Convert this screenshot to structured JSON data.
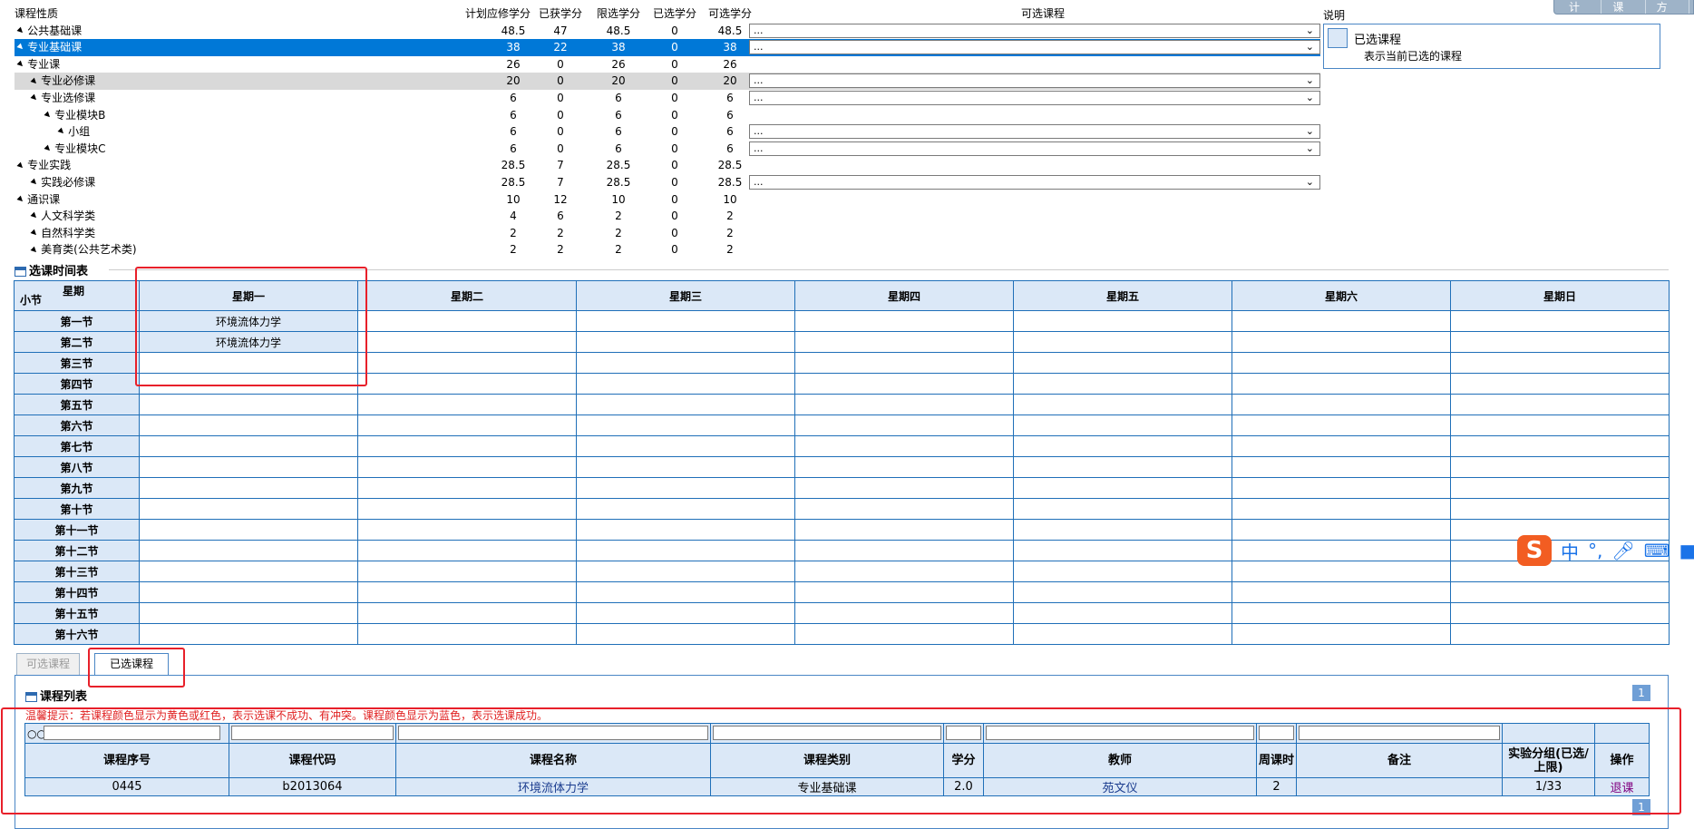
{
  "top_buttons": [
    "计划",
    "课表",
    "方案"
  ],
  "plan": {
    "headers": {
      "name": "课程性质",
      "c1": "计划应修学分",
      "c2": "已获学分",
      "c3": "限选学分",
      "c4": "已选学分",
      "c5": "可选学分",
      "avail": "可选课程"
    },
    "rows": [
      {
        "name": "公共基础课",
        "level": 0,
        "v": [
          "48.5",
          "47",
          "48.5",
          "0",
          "48.5"
        ],
        "dropdown": "..."
      },
      {
        "name": "专业基础课",
        "level": 0,
        "v": [
          "38",
          "22",
          "38",
          "0",
          "38"
        ],
        "dropdown": "...",
        "selected": true
      },
      {
        "name": "专业课",
        "level": 0,
        "v": [
          "26",
          "0",
          "26",
          "0",
          "26"
        ]
      },
      {
        "name": "专业必修课",
        "level": 1,
        "v": [
          "20",
          "0",
          "20",
          "0",
          "20"
        ],
        "dropdown": "...",
        "highlight": true
      },
      {
        "name": "专业选修课",
        "level": 1,
        "v": [
          "6",
          "0",
          "6",
          "0",
          "6"
        ],
        "dropdown": "..."
      },
      {
        "name": "专业模块B",
        "level": 2,
        "v": [
          "6",
          "0",
          "6",
          "0",
          "6"
        ]
      },
      {
        "name": "小组",
        "level": 3,
        "v": [
          "6",
          "0",
          "6",
          "0",
          "6"
        ],
        "dropdown": "..."
      },
      {
        "name": "专业模块C",
        "level": 2,
        "v": [
          "6",
          "0",
          "6",
          "0",
          "6"
        ],
        "dropdown": "..."
      },
      {
        "name": "专业实践",
        "level": 0,
        "v": [
          "28.5",
          "7",
          "28.5",
          "0",
          "28.5"
        ]
      },
      {
        "name": "实践必修课",
        "level": 1,
        "v": [
          "28.5",
          "7",
          "28.5",
          "0",
          "28.5"
        ],
        "dropdown": "..."
      },
      {
        "name": "通识课",
        "level": 0,
        "v": [
          "10",
          "12",
          "10",
          "0",
          "10"
        ]
      },
      {
        "name": "人文科学类",
        "level": 1,
        "v": [
          "4",
          "6",
          "2",
          "0",
          "2"
        ]
      },
      {
        "name": "自然科学类",
        "level": 1,
        "v": [
          "2",
          "2",
          "2",
          "0",
          "2"
        ]
      },
      {
        "name": "美育类(公共艺术类)",
        "level": 1,
        "v": [
          "2",
          "2",
          "2",
          "0",
          "2"
        ]
      }
    ]
  },
  "legend": {
    "title": "说明",
    "item": "已选课程",
    "desc": "表示当前已选的课程"
  },
  "timetable": {
    "title": "选课时间表",
    "corner_top": "星期",
    "corner_bottom": "小节",
    "days": [
      "星期一",
      "星期二",
      "星期三",
      "星期四",
      "星期五",
      "星期六",
      "星期日"
    ],
    "slots": [
      "第一节",
      "第二节",
      "第三节",
      "第四节",
      "第五节",
      "第六节",
      "第七节",
      "第八节",
      "第九节",
      "第十节",
      "第十一节",
      "第十二节",
      "第十三节",
      "第十四节",
      "第十五节",
      "第十六节"
    ],
    "entries": [
      {
        "slot": 0,
        "day": 0,
        "course": "环境流体力学"
      },
      {
        "slot": 1,
        "day": 0,
        "course": "环境流体力学"
      }
    ]
  },
  "tabs": [
    {
      "label": "可选课程",
      "active": false
    },
    {
      "label": "已选课程",
      "active": true
    }
  ],
  "course_list": {
    "title": "课程列表",
    "page": "1",
    "tip": "温馨提示：若课程颜色显示为黄色或红色，表示选课不成功、有冲突。课程颜色显示为蓝色，表示选课成功。",
    "columns": [
      "课程序号",
      "课程代码",
      "课程名称",
      "课程类别",
      "学分",
      "教师",
      "周课时",
      "备注",
      "实验分组(已选/上限)",
      "操作"
    ],
    "rows": [
      {
        "seq": "0445",
        "code": "b2013064",
        "name": "环境流体力学",
        "category": "专业基础课",
        "credit": "2.0",
        "teacher": "苑文仪",
        "hours": "2",
        "note": "",
        "group": "1/33",
        "action": "退课"
      }
    ]
  },
  "ime": {
    "logo": "S",
    "lang": "中",
    "punct": "°,",
    "icons": [
      "microphone-icon",
      "keyboard-icon",
      "skin-icon"
    ]
  }
}
